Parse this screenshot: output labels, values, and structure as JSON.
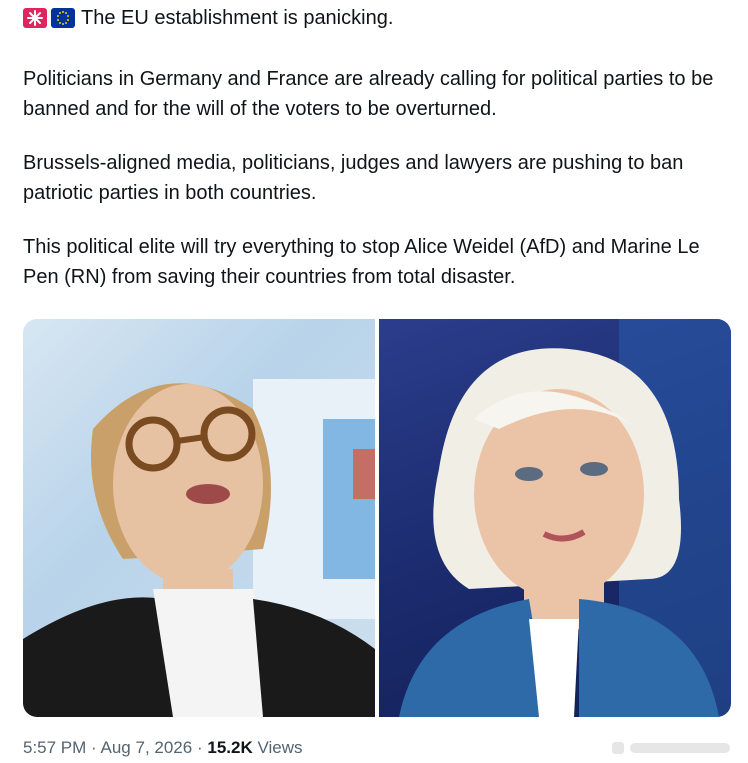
{
  "tweet": {
    "line1": "The EU establishment is panicking.",
    "para1": "Politicians in Germany and France are already calling for political parties to be banned and for the will of the voters to be overturned.",
    "para2": "Brussels-aligned media, politicians, judges and lawyers are pushing to ban patriotic parties in both countries.",
    "para3": "This political elite will try everything to stop Alice Weidel (AfD) and Marine Le Pen (RN) from saving their countries from total disaster.",
    "emojis": [
      "siren-icon",
      "eu-flag-icon"
    ]
  },
  "footer": {
    "time": "5:57 PM",
    "separator": "·",
    "date": "Aug 7, 2026",
    "views_count": "15.2K",
    "views_label": "Views"
  },
  "colors": {
    "text": "#0f1419",
    "muted": "#536471",
    "left_photo_bg": "#cfe0ee",
    "right_photo_bg": "#1a2a6c"
  }
}
